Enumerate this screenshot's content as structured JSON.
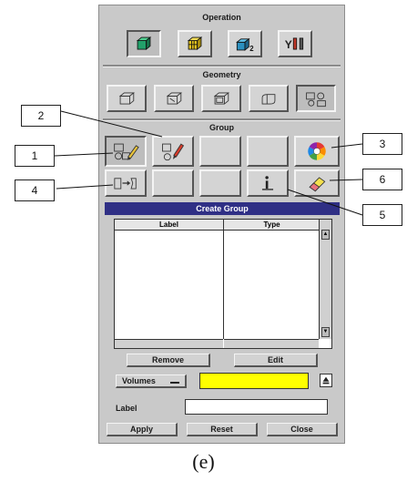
{
  "operation": {
    "title": "Operation",
    "icons": [
      "geometry-icon",
      "mesh-icon",
      "boundary-zones-icon",
      "tools-icon"
    ]
  },
  "geometry": {
    "title": "Geometry",
    "icons": [
      "vertex-icon",
      "edge-icon",
      "face-icon",
      "volume-icon",
      "group-icon"
    ]
  },
  "group": {
    "title": "Group",
    "row1_icons": [
      "create-group-icon",
      "modify-group-icon",
      "",
      "",
      "color-wheel-icon"
    ],
    "row2_icons": [
      "move-icon",
      "",
      "",
      "info-icon",
      "eraser-icon"
    ]
  },
  "create_group": {
    "title": "Create Group",
    "columns": [
      "Label",
      "Type"
    ],
    "remove_label": "Remove",
    "edit_label": "Edit",
    "entity_option": "Volumes",
    "highlight_color": "#ffff00",
    "label_field_label": "Label",
    "label_value": "",
    "apply_label": "Apply",
    "reset_label": "Reset",
    "close_label": "Close"
  },
  "callouts": [
    "1",
    "2",
    "3",
    "4",
    "5",
    "6"
  ],
  "caption": "(e)"
}
